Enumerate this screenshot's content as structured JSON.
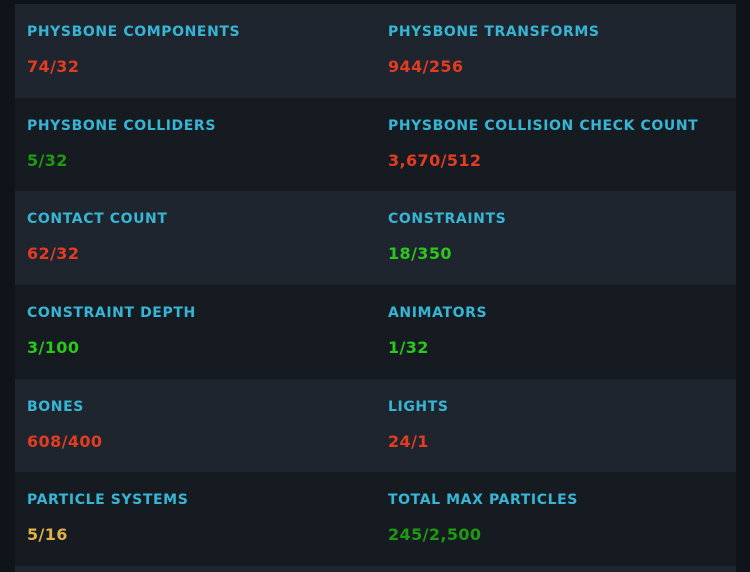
{
  "rows": [
    {
      "left": {
        "label": "PHYSBONE COMPONENTS",
        "value": "74/32",
        "status": "red"
      },
      "right": {
        "label": "PHYSBONE TRANSFORMS",
        "value": "944/256",
        "status": "red"
      }
    },
    {
      "left": {
        "label": "PHYSBONE COLLIDERS",
        "value": "5/32",
        "status": "green-dark"
      },
      "right": {
        "label": "PHYSBONE COLLISION CHECK COUNT",
        "value": "3,670/512",
        "status": "red"
      }
    },
    {
      "left": {
        "label": "CONTACT COUNT",
        "value": "62/32",
        "status": "red"
      },
      "right": {
        "label": "CONSTRAINTS",
        "value": "18/350",
        "status": "green"
      }
    },
    {
      "left": {
        "label": "CONSTRAINT DEPTH",
        "value": "3/100",
        "status": "green"
      },
      "right": {
        "label": "ANIMATORS",
        "value": "1/32",
        "status": "green"
      }
    },
    {
      "left": {
        "label": "BONES",
        "value": "608/400",
        "status": "red"
      },
      "right": {
        "label": "LIGHTS",
        "value": "24/1",
        "status": "red"
      }
    },
    {
      "left": {
        "label": "PARTICLE SYSTEMS",
        "value": "5/16",
        "status": "yellow"
      },
      "right": {
        "label": "TOTAL MAX PARTICLES",
        "value": "245/2,500",
        "status": "green-dark"
      }
    }
  ],
  "colors": {
    "label": "#36b6d4",
    "red": "#e23c22",
    "green": "#2bc71d",
    "green_dark": "#1e9a12",
    "yellow": "#e0b14a",
    "row_alt": "#1f252e",
    "row_plain": "#161b22",
    "background": "#0f141a"
  }
}
